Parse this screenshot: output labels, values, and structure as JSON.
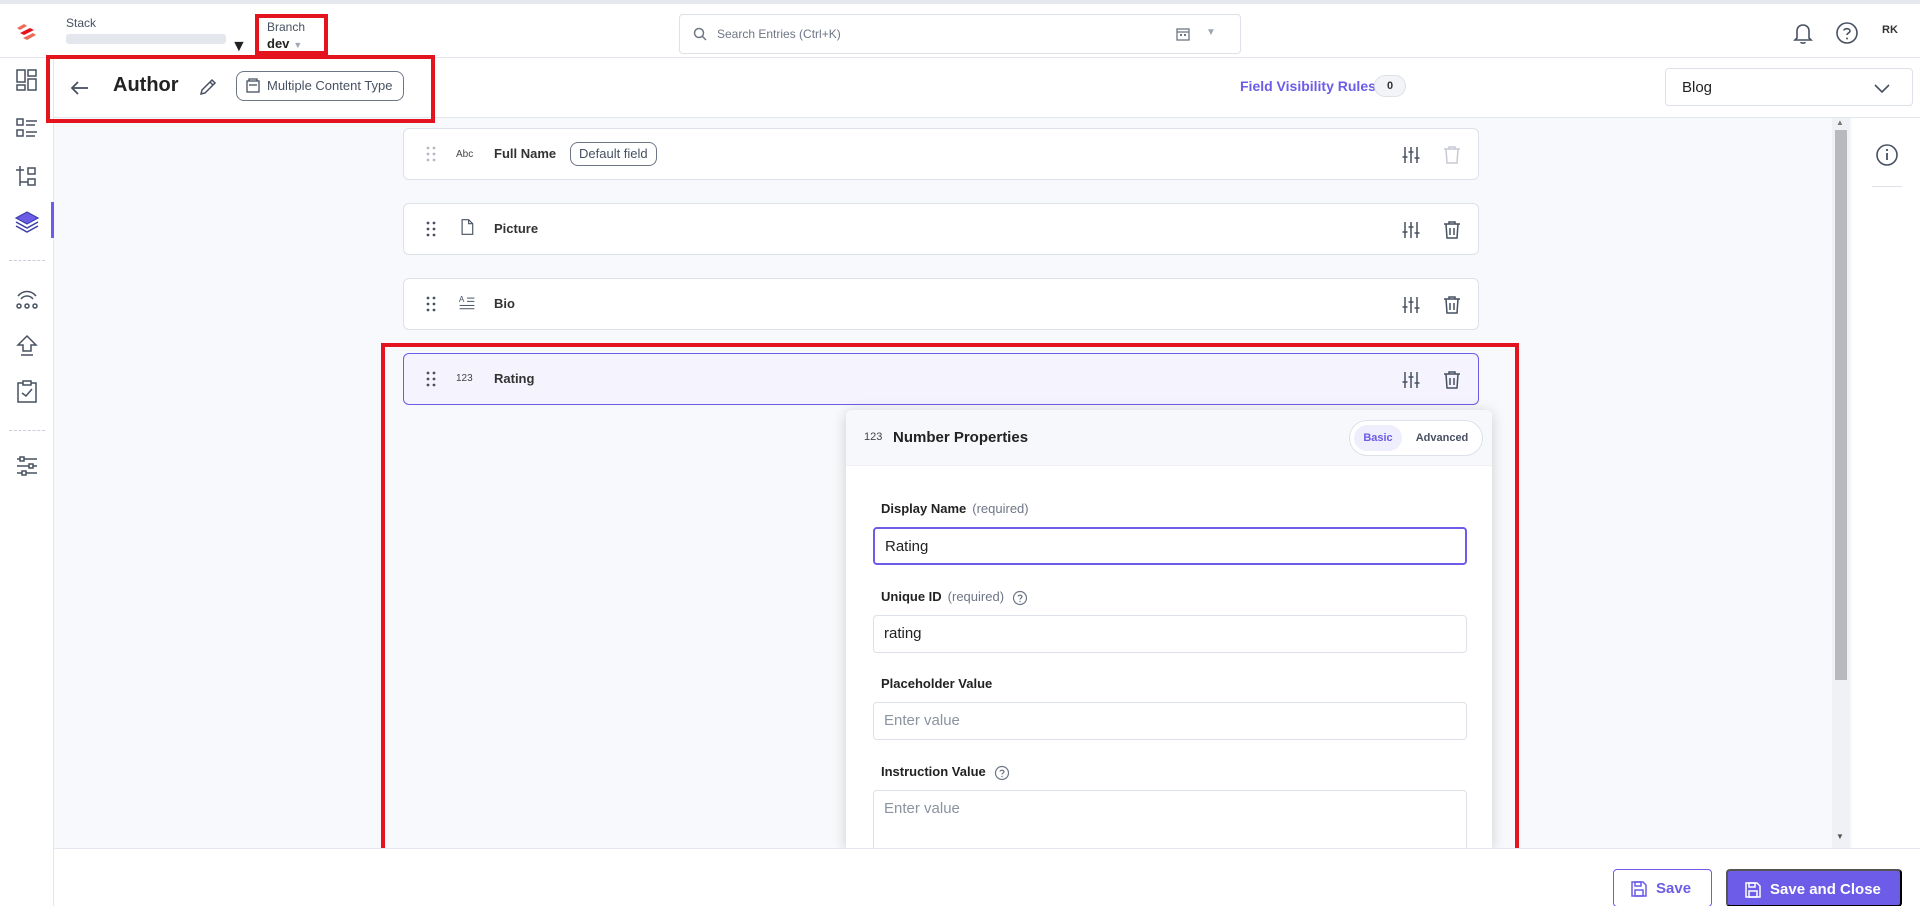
{
  "topbar": {
    "stack_label": "Stack",
    "branch_label": "Branch",
    "branch_value": "dev",
    "search_placeholder": "Search Entries (Ctrl+K)",
    "avatar_initials": "RK"
  },
  "header": {
    "title": "Author",
    "content_type_badge": "Multiple Content Type",
    "field_visibility_label": "Field Visibility Rules",
    "field_visibility_count": "0",
    "template_select": "Blog"
  },
  "fields": [
    {
      "type_icon": "Abc",
      "name": "Full Name",
      "badge": "Default field"
    },
    {
      "type_icon": "file-icon",
      "name": "Picture"
    },
    {
      "type_icon": "multiline-text-icon",
      "name": "Bio"
    },
    {
      "type_icon": "123",
      "name": "Rating"
    }
  ],
  "properties": {
    "type_icon": "123",
    "title": "Number Properties",
    "tab_basic": "Basic",
    "tab_advanced": "Advanced",
    "display_name_label": "Display Name",
    "required_label": "(required)",
    "display_name_value": "Rating",
    "unique_id_label": "Unique ID",
    "unique_id_value": "rating",
    "placeholder_label": "Placeholder Value",
    "placeholder_ph": "Enter value",
    "instruction_label": "Instruction Value",
    "instruction_ph": "Enter value"
  },
  "footer": {
    "save_label": "Save",
    "save_close_label": "Save and Close"
  },
  "colors": {
    "accent": "#6c5ce7",
    "highlight_red": "#e3141e"
  }
}
